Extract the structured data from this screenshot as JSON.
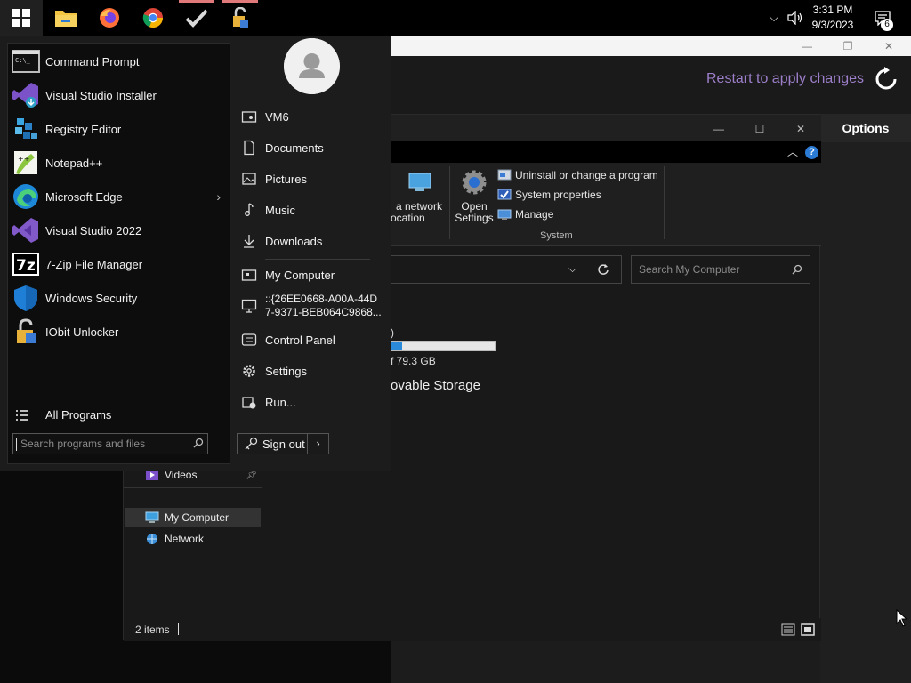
{
  "taskbar": {
    "clock_time": "3:31 PM",
    "clock_date": "9/3/2023",
    "notification_count": "6"
  },
  "settings_window": {
    "restart_text": "Restart to apply changes",
    "options_label": "Options"
  },
  "explorer": {
    "ribbon": {
      "network_location_line1": "a network",
      "network_location_line2": "ocation",
      "open_settings_line1": "Open",
      "open_settings_line2": "Settings",
      "uninstall": "Uninstall or change a program",
      "system_properties": "System properties",
      "manage": "Manage",
      "group_label": "System"
    },
    "search_placeholder": "Search My Computer",
    "drive_label_fragment": ")",
    "drive_free_text": "f 79.3 GB",
    "drive_used_fraction": 0.1,
    "section_title": "ovable Storage",
    "nav": {
      "videos": "Videos",
      "my_computer": "My Computer",
      "network": "Network"
    },
    "status_text": "2 items"
  },
  "start_menu": {
    "apps": [
      {
        "label": "Command Prompt"
      },
      {
        "label": "Visual Studio Installer"
      },
      {
        "label": "Registry Editor"
      },
      {
        "label": "Notepad++"
      },
      {
        "label": "Microsoft Edge"
      },
      {
        "label": "Visual Studio 2022"
      },
      {
        "label": "7-Zip File Manager"
      },
      {
        "label": "Windows Security"
      },
      {
        "label": "IObit Unlocker"
      }
    ],
    "all_programs": "All Programs",
    "search_placeholder": "Search programs and files",
    "places": {
      "user": "VM6",
      "documents": "Documents",
      "pictures": "Pictures",
      "music": "Music",
      "downloads": "Downloads",
      "my_computer": "My Computer",
      "guid_line1": "::{26EE0668-A00A-44D",
      "guid_line2": "7-9371-BEB064C9868...",
      "control_panel": "Control Panel",
      "settings": "Settings",
      "run": "Run..."
    },
    "sign_out": "Sign out"
  }
}
